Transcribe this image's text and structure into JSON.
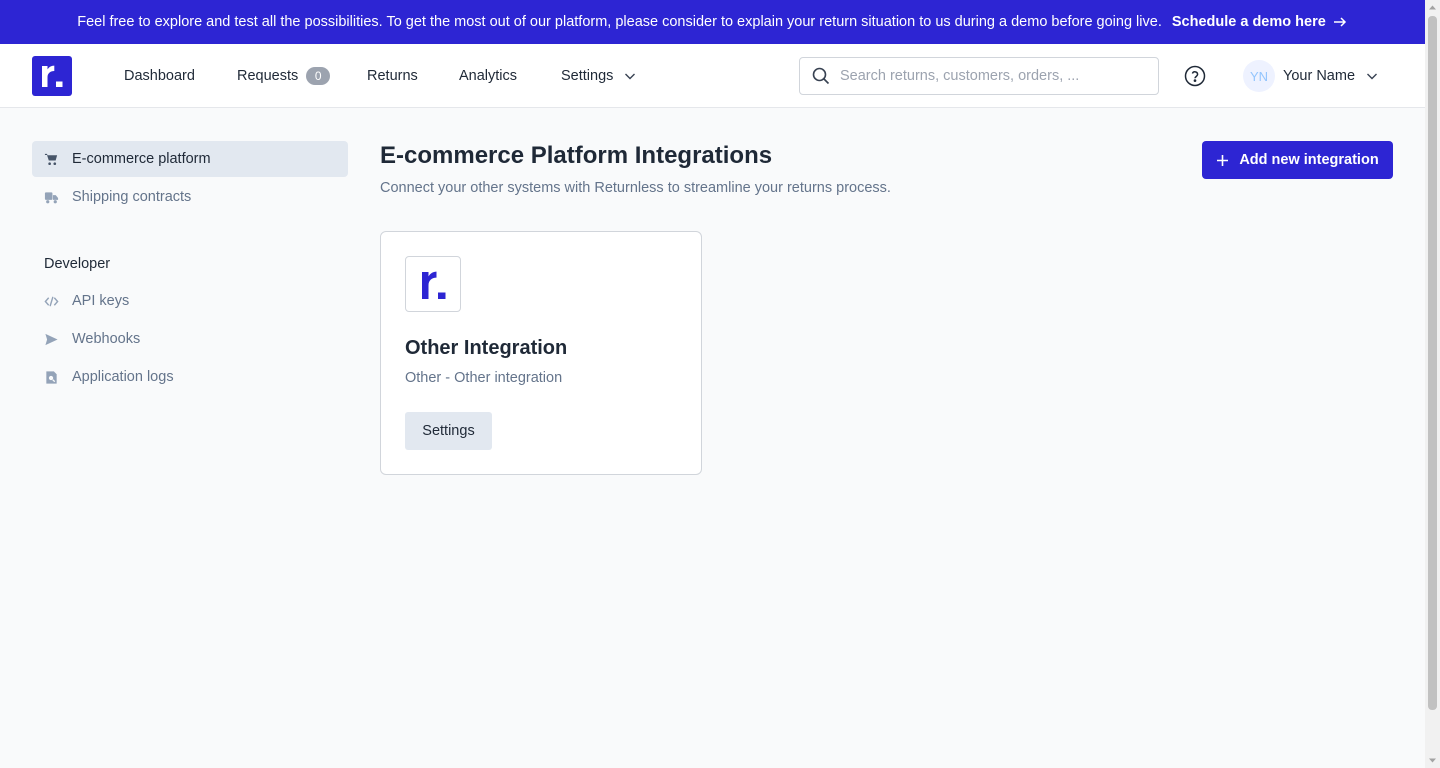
{
  "banner": {
    "message": "Feel free to explore and test all the possibilities. To get the most out of our platform, please consider to explain your return situation to us during a demo before going live.",
    "cta_label": "Schedule a demo here",
    "background": "#2d25d3"
  },
  "nav": {
    "items": [
      {
        "label": "Dashboard"
      },
      {
        "label": "Requests",
        "badge": "0"
      },
      {
        "label": "Returns"
      },
      {
        "label": "Analytics"
      },
      {
        "label": "Settings",
        "icon": "chevron-down-icon"
      }
    ],
    "search_placeholder": "Search returns, customers, orders, ...",
    "user": {
      "initials": "YN",
      "name": "Your Name"
    }
  },
  "sidebar": {
    "items": [
      {
        "label": "E-commerce platform",
        "icon": "cart-icon",
        "active": true
      },
      {
        "label": "Shipping contracts",
        "icon": "truck-icon"
      }
    ],
    "developer_heading": "Developer",
    "developer_items": [
      {
        "label": "API keys",
        "icon": "code-icon"
      },
      {
        "label": "Webhooks",
        "icon": "send-icon"
      },
      {
        "label": "Application logs",
        "icon": "log-search-icon"
      }
    ]
  },
  "main": {
    "title": "E-commerce Platform Integrations",
    "subtitle": "Connect your other systems with Returnless to streamline your returns process.",
    "add_button_label": "Add new integration",
    "integration": {
      "title": "Other Integration",
      "subtitle": "Other - Other integration",
      "settings_label": "Settings"
    }
  },
  "colors": {
    "brand": "#2d25d3",
    "active_bg": "#e2e8f0",
    "muted_text": "#64748b"
  }
}
